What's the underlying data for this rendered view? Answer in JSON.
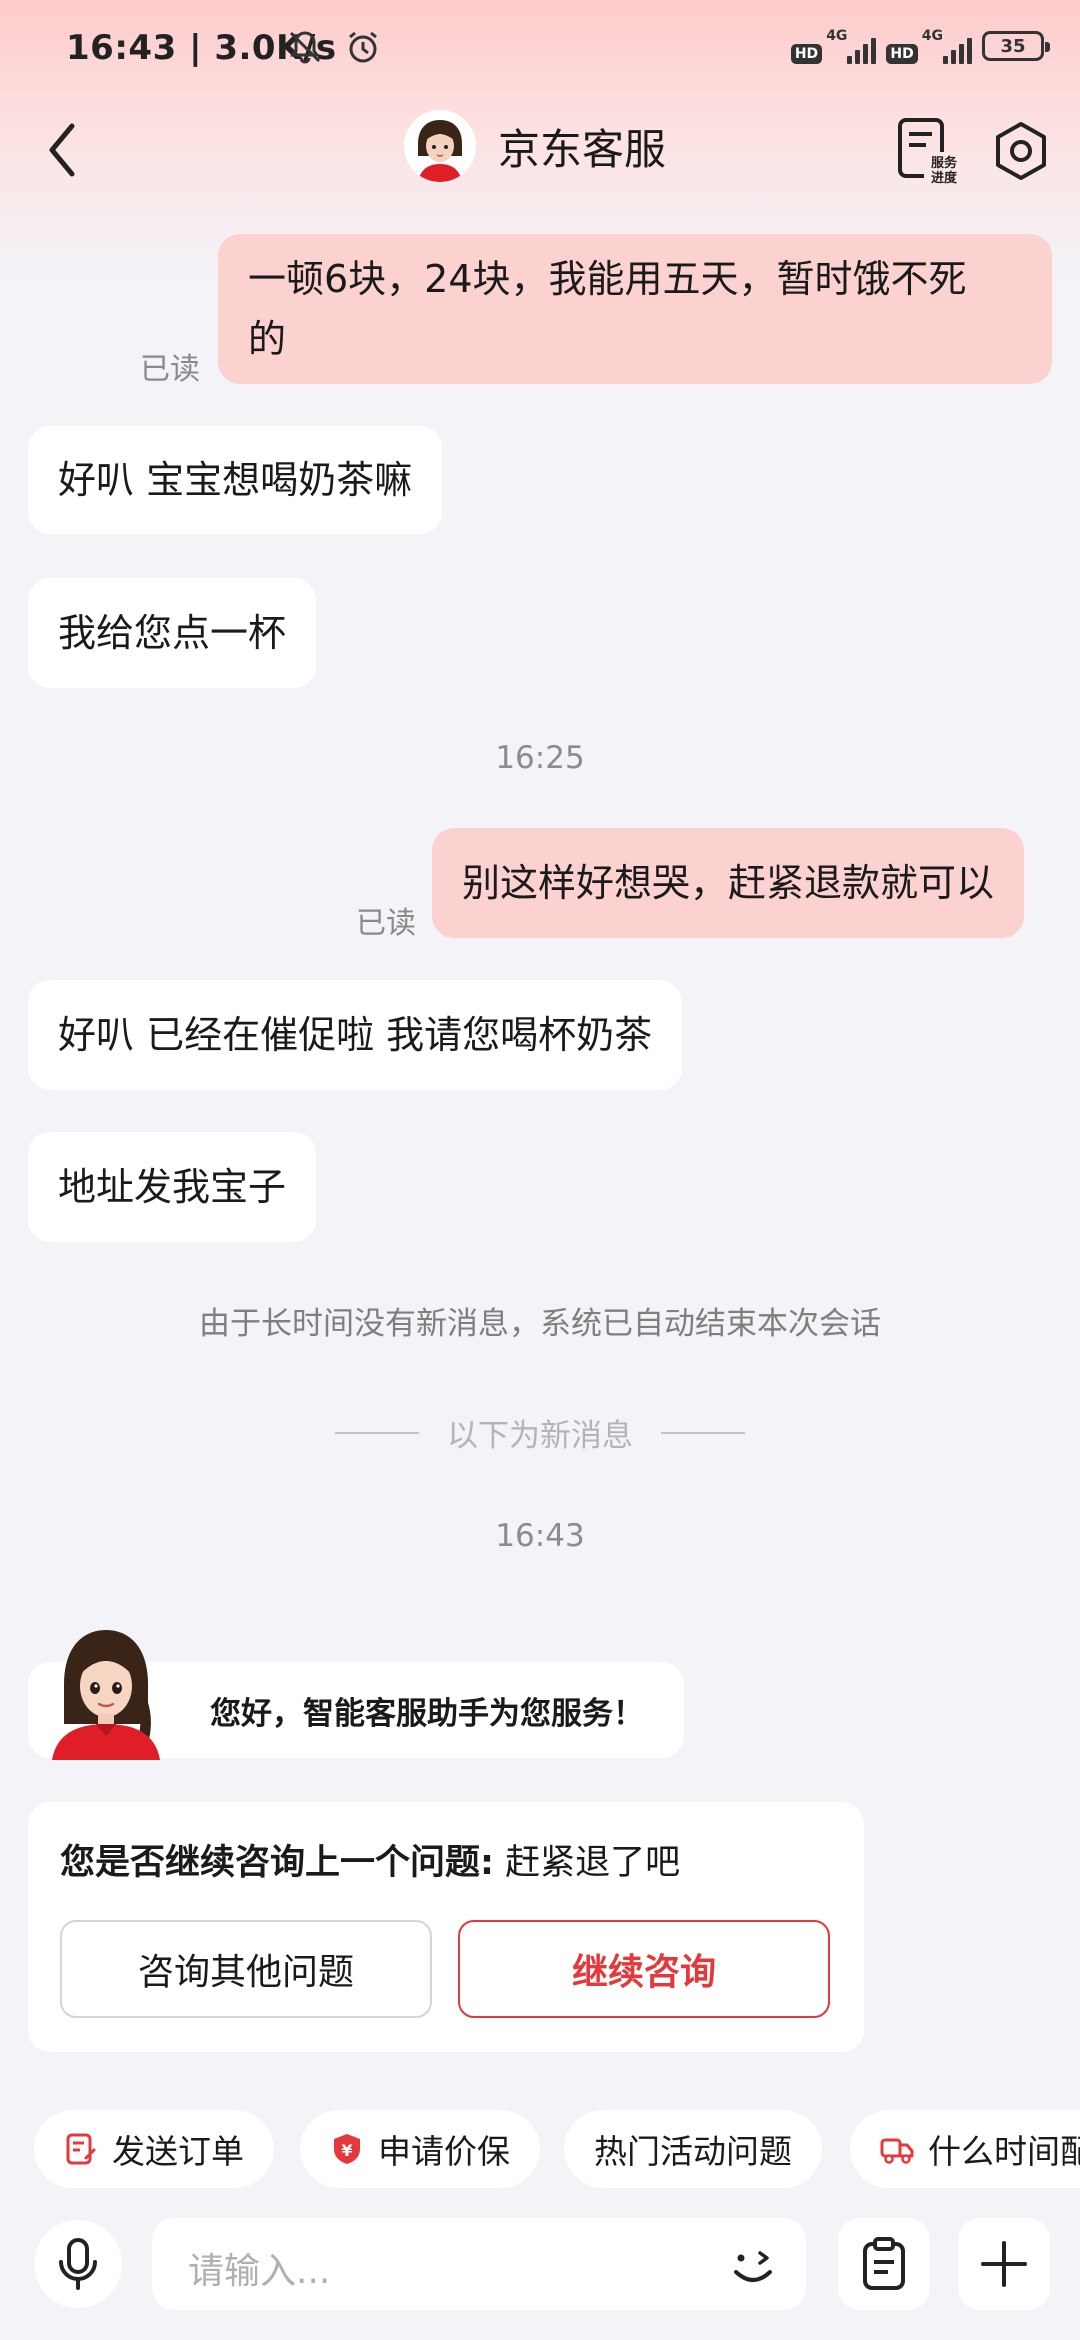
{
  "status_bar": {
    "time": "16:43 | 3.0K/s",
    "hd1": "HD",
    "net1": "4G",
    "hd2": "HD",
    "net2": "4G",
    "battery": "35"
  },
  "header": {
    "title": "京东客服",
    "service_progress_label": "服务进度"
  },
  "messages": [
    {
      "from": "user",
      "text": "一顿6块，24块，我能用五天，暂时饿不死的",
      "line1": "一顿6块，24块，我能用五天，暂时饿不死",
      "line2": "的",
      "status": "已读"
    },
    {
      "from": "agent",
      "text": "好叭 宝宝想喝奶茶嘛"
    },
    {
      "from": "agent",
      "text": "我给您点一杯"
    },
    {
      "type": "time",
      "text": "16:25"
    },
    {
      "from": "user",
      "text": "别这样好想哭，赶紧退款就可以",
      "status": "已读"
    },
    {
      "from": "agent",
      "text": "好叭 已经在催促啦 我请您喝杯奶茶"
    },
    {
      "from": "agent",
      "text": "地址发我宝子"
    },
    {
      "type": "system",
      "text": "由于长时间没有新消息，系统已自动结束本次会话"
    },
    {
      "type": "divider",
      "text": "以下为新消息"
    },
    {
      "type": "time",
      "text": "16:43"
    }
  ],
  "greeting": {
    "text": "您好，智能客服助手为您服务！"
  },
  "prompt_card": {
    "question": "您是否继续咨询上一个问题:",
    "topic": " 赶紧退了吧",
    "other_button": "咨询其他问题",
    "continue_button": "继续咨询"
  },
  "quick_actions": [
    {
      "label": "发送订单",
      "icon": "order-edit-icon"
    },
    {
      "label": "申请价保",
      "icon": "price-protect-shield-icon"
    },
    {
      "label": "热门活动问题",
      "icon": ""
    },
    {
      "label": "什么时间配",
      "icon": "delivery-truck-icon"
    }
  ],
  "input": {
    "placeholder": "请输入..."
  },
  "colors": {
    "accent": "#e4393c",
    "user_bubble": "#fcd2d0",
    "background": "#f3f3f8"
  }
}
